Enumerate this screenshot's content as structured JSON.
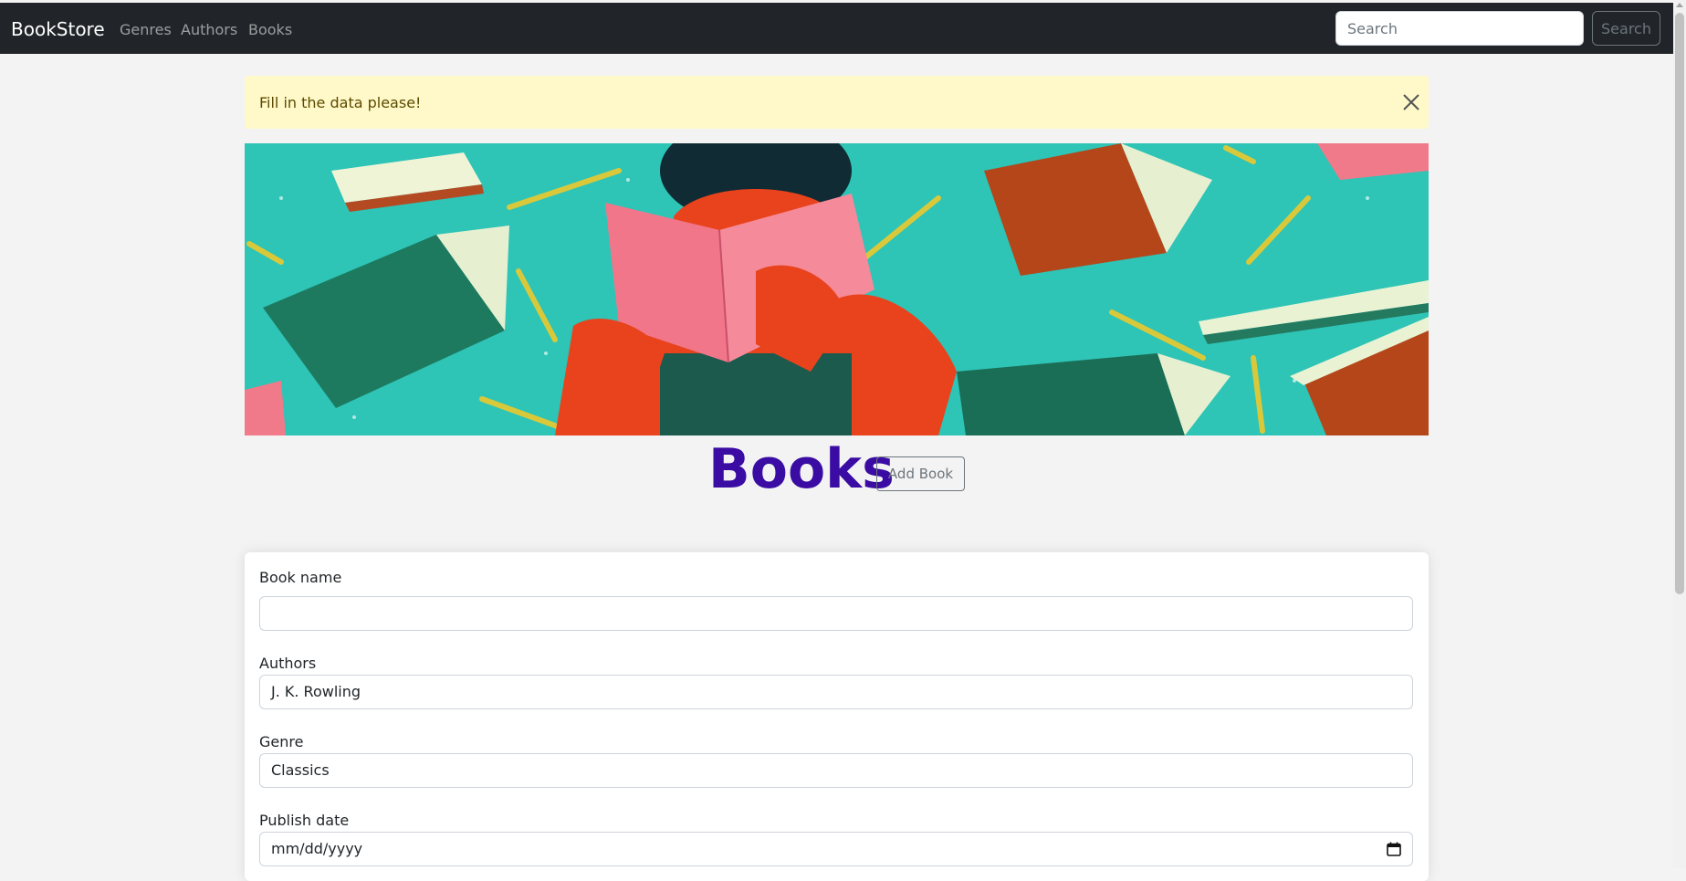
{
  "navbar": {
    "brand": "BookStore",
    "links": [
      "Genres",
      "Authors",
      "Books"
    ],
    "search_placeholder": "Search",
    "search_button": "Search"
  },
  "alert": {
    "message": "Fill in the data please!",
    "close_icon": "close-icon"
  },
  "hero": {
    "description_icon": "banner-image"
  },
  "page": {
    "title": "Books",
    "add_button": "Add Book",
    "title_color": "#3a0ca3"
  },
  "form": {
    "book_name": {
      "label": "Book name",
      "value": ""
    },
    "authors": {
      "label": "Authors",
      "value": "J. K. Rowling"
    },
    "genre": {
      "label": "Genre",
      "value": "Classics"
    },
    "publish_date": {
      "label": "Publish date",
      "value": "mm/dd/yyyy",
      "icon": "calendar-icon"
    }
  },
  "colors": {
    "navbar_bg": "#212529",
    "page_bg": "#f3f3f3",
    "alert_bg": "#fff9c9",
    "hero_teal": "#2ec4b6",
    "hero_red": "#e8431c"
  }
}
